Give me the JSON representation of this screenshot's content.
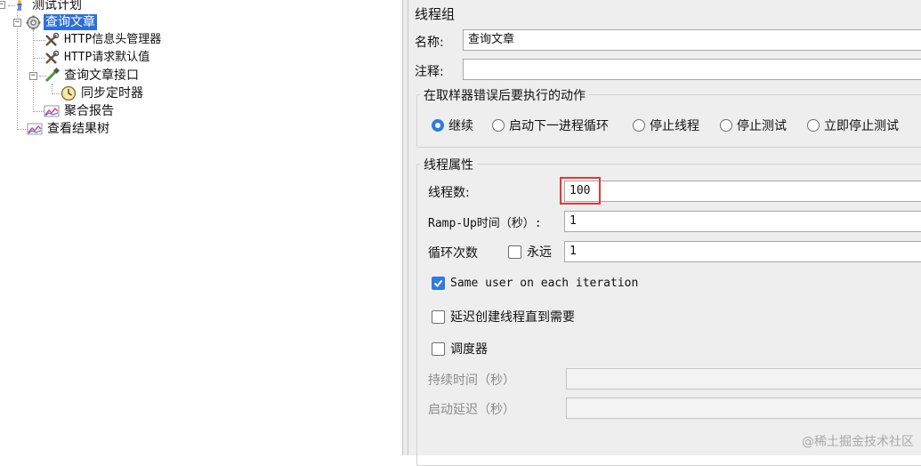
{
  "tree": {
    "test_plan": "测试计划",
    "thread_group": "查询文章",
    "header_manager": "HTTP信息头管理器",
    "request_defaults": "HTTP请求默认值",
    "sampler": "查询文章接口",
    "timer": "同步定时器",
    "aggregate_report": "聚合报告",
    "results_tree": "查看结果树"
  },
  "panel": {
    "title": "线程组",
    "name_label": "名称:",
    "name_value": "查询文章",
    "comment_label": "注释:",
    "comment_value": "",
    "error_group_title": "在取样器错误后要执行的动作",
    "error_actions": [
      "继续",
      "启动下一进程循环",
      "停止线程",
      "停止测试",
      "立即停止测试"
    ],
    "selected_action": "继续",
    "thread_props_title": "线程属性",
    "threads_label": "线程数:",
    "threads_value": "100",
    "rampup_label": "Ramp-Up时间（秒）:",
    "rampup_value": "1",
    "loop_label": "循环次数",
    "forever_label": "永远",
    "forever_checked": false,
    "loop_value": "1",
    "same_user_label": "Same user on each iteration",
    "same_user_checked": true,
    "delay_label": "延迟创建线程直到需要",
    "delay_checked": false,
    "scheduler_label": "调度器",
    "scheduler_checked": false,
    "duration_label": "持续时间（秒）",
    "duration_value": "",
    "startup_delay_label": "启动延迟（秒）",
    "startup_delay_value": ""
  },
  "watermark": "@稀土掘金技术社区",
  "colors": {
    "selection": "#2f6fd6",
    "accent": "#2f7be0",
    "highlight": "#e03a3a",
    "panel_bg": "#eeeeee"
  }
}
